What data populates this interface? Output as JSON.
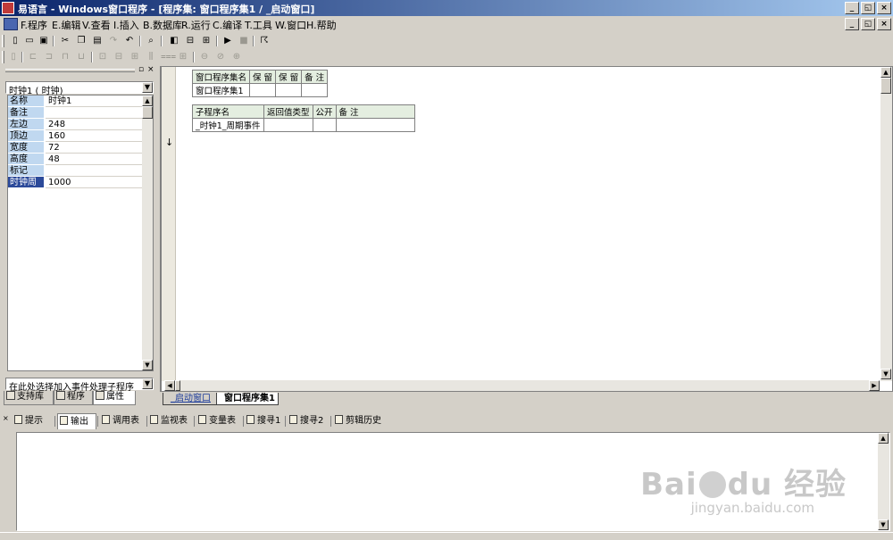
{
  "window": {
    "title": "易语言 - Windows窗口程序 - [程序集: 窗口程序集1 / _启动窗口]",
    "buttons": [
      "_",
      "◱",
      "×"
    ]
  },
  "menu": [
    "F.程序",
    "E.编辑",
    "V.查看",
    "I.插入",
    "B.数据库",
    "R.运行",
    "C.编译",
    "T.工具",
    "W.窗口",
    "H.帮助"
  ],
  "left_panel": {
    "object_select": "时钟1 ( 时钟)",
    "properties": [
      {
        "k": "名称",
        "v": "时钟1"
      },
      {
        "k": "备注",
        "v": ""
      },
      {
        "k": "左边",
        "v": "248"
      },
      {
        "k": "顶边",
        "v": "160"
      },
      {
        "k": "宽度",
        "v": "72"
      },
      {
        "k": "高度",
        "v": "48"
      },
      {
        "k": "标记",
        "v": ""
      },
      {
        "k": "时钟周期",
        "v": "1000"
      }
    ],
    "event_select": "在此处选择加入事件处理子程序",
    "tabs": [
      "支持库",
      "程序",
      "属性"
    ]
  },
  "editor": {
    "assembly_table": {
      "header": [
        "窗口程序集名",
        "保 留",
        "保 留",
        "备 注"
      ],
      "row": [
        "窗口程序集1",
        "",
        "",
        ""
      ]
    },
    "sub_table": {
      "header": [
        "子程序名",
        "返回值类型",
        "公开",
        "备 注"
      ],
      "row": [
        "_时钟1_周期事件",
        "",
        "",
        ""
      ]
    },
    "arrow": "↓"
  },
  "doc_tabs": [
    "_启动窗口",
    "窗口程序集1"
  ],
  "output_tabs": [
    "提示",
    "输出",
    "调用表",
    "监视表",
    "变量表",
    "搜寻1",
    "搜寻2",
    "剪辑历史"
  ],
  "watermark": {
    "main": "Bai",
    "main2": "du",
    "main3": "经验",
    "sub": "jingyan.baidu.com"
  }
}
